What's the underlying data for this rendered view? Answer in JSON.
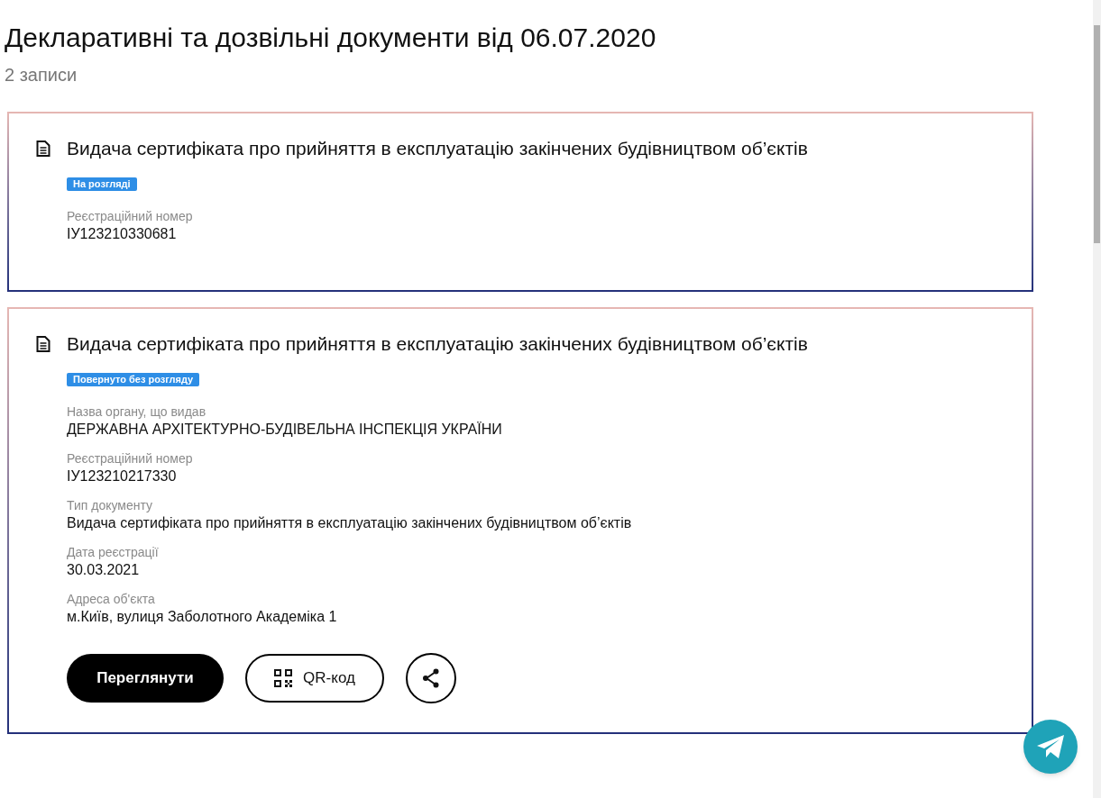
{
  "header": {
    "title": "Декларативні та дозвільні документи від 06.07.2020",
    "count": "2 записи"
  },
  "documents": [
    {
      "title": "Видача сертифіката про прийняття в експлуатацію закінчених будівництвом об’єктів",
      "status": "На розгляді",
      "fields": [
        {
          "label": "Реєстраційний номер",
          "value": "ІУ123210330681"
        }
      ]
    },
    {
      "title": "Видача сертифіката про прийняття в експлуатацію закінчених будівництвом об’єктів",
      "status": "Повернуто без розгляду",
      "fields": [
        {
          "label": "Назва органу, що видав",
          "value": "ДЕРЖАВНА АРХІТЕКТУРНО-БУДІВЕЛЬНА ІНСПЕКЦІЯ УКРАЇНИ"
        },
        {
          "label": "Реєстраційний номер",
          "value": "ІУ123210217330"
        },
        {
          "label": "Тип документу",
          "value": "Видача сертифіката про прийняття в експлуатацію закінчених будівництвом об’єктів"
        },
        {
          "label": "Дата реєстрації",
          "value": "30.03.2021"
        },
        {
          "label": "Адреса об'єкта",
          "value": "м.Київ, вулиця Заболотного Академіка 1"
        }
      ],
      "actions": {
        "view": "Переглянути",
        "qr": "QR-код"
      }
    }
  ]
}
